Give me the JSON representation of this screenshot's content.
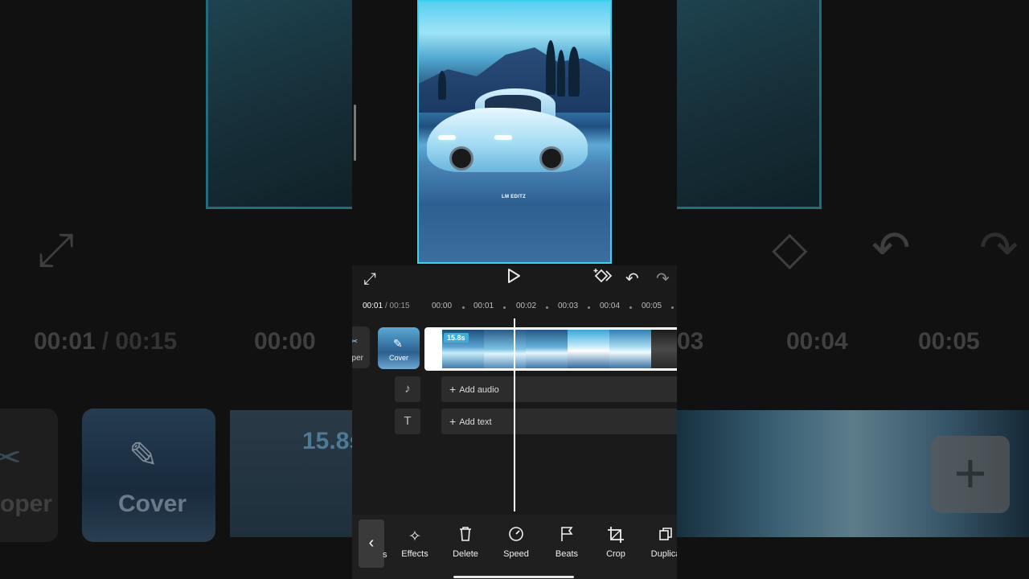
{
  "app": {
    "watermark": "LM EDITZ",
    "accent": "#35d2f2",
    "background": "#1a1a1a"
  },
  "background": {
    "time_current": "00:01",
    "time_separator": "/ 00:15",
    "tick_left": "00:00",
    "tick_right_a": "03",
    "tick_right_b": "00:04",
    "tick_right_c": "00:05",
    "stopper_text": "oper",
    "cover_text": "Cover",
    "badge_text": "15.8s"
  },
  "preview": {
    "controls": {
      "fullscreen_icon": "fullscreen-icon",
      "play_icon": "play-icon",
      "keyframe_icon": "keyframe-icon",
      "undo_icon": "undo-icon",
      "redo_icon": "redo-icon"
    }
  },
  "timeline": {
    "current_time": "00:01",
    "total_time": "/ 00:15",
    "ticks": [
      "00:00",
      "00:01",
      "00:02",
      "00:03",
      "00:04",
      "00:05"
    ],
    "stopper_label": "oper",
    "cover_label": "Cover",
    "clip_duration": "15.8s",
    "add_clip_label": "+",
    "add_audio_label": "Add audio",
    "add_text_label": "Add text",
    "audio_icon": "music-note-icon",
    "text_icon": "text-icon"
  },
  "toolbar": {
    "back_label": "‹",
    "partial_label": "s",
    "tools": [
      {
        "label": "Effects",
        "icon": "effects-icon"
      },
      {
        "label": "Delete",
        "icon": "delete-icon"
      },
      {
        "label": "Speed",
        "icon": "speed-icon"
      },
      {
        "label": "Beats",
        "icon": "beats-icon"
      },
      {
        "label": "Crop",
        "icon": "crop-icon"
      },
      {
        "label": "Duplica",
        "icon": "duplicate-icon"
      }
    ]
  }
}
